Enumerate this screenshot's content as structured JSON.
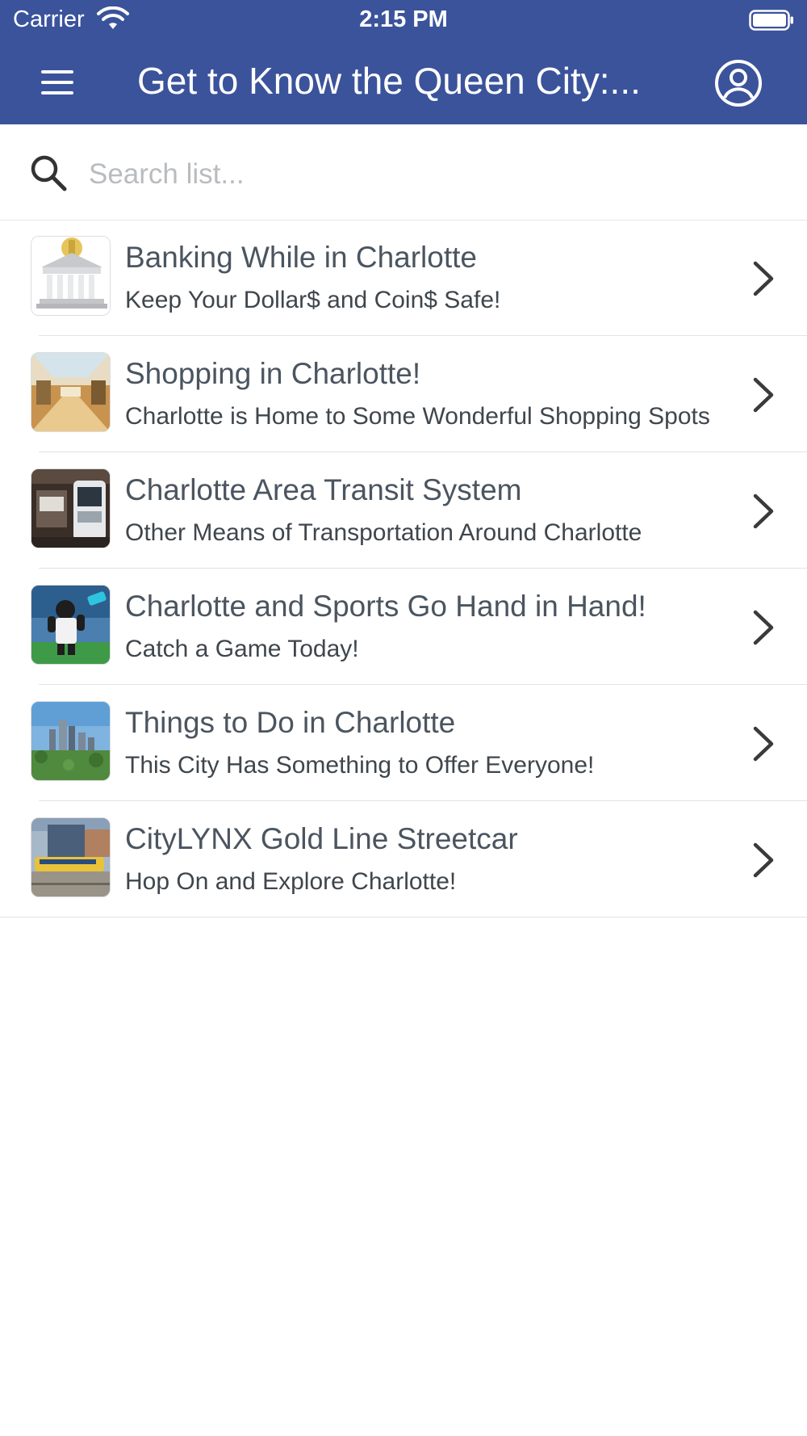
{
  "status_bar": {
    "carrier": "Carrier",
    "time": "2:15 PM",
    "wifi_icon": "wifi-icon",
    "battery_icon": "battery-icon"
  },
  "header": {
    "title": "Get to Know the Queen City:...",
    "menu_icon": "hamburger-menu-icon",
    "account_icon": "account-circle-icon",
    "background_color": "#3b539b"
  },
  "search": {
    "placeholder": "Search list...",
    "value": "",
    "icon": "search-icon"
  },
  "items": [
    {
      "title": "Banking While in Charlotte",
      "subtitle": "Keep Your Dollar$ and Coin$ Safe!",
      "thumbnail": "bank-building-image"
    },
    {
      "title": "Shopping in Charlotte!",
      "subtitle": "Charlotte is Home to Some Wonderful Shopping Spots",
      "thumbnail": "shopping-mall-image"
    },
    {
      "title": "Charlotte Area Transit System",
      "subtitle": "Other Means of Transportation Around Charlotte",
      "thumbnail": "bus-station-image"
    },
    {
      "title": "Charlotte and Sports Go Hand in Hand!",
      "subtitle": "Catch a Game Today!",
      "thumbnail": "sports-mascot-image"
    },
    {
      "title": "Things to Do in Charlotte",
      "subtitle": "This City Has Something to Offer Everyone!",
      "thumbnail": "city-skyline-image"
    },
    {
      "title": "CityLYNX Gold Line Streetcar",
      "subtitle": "Hop On and Explore Charlotte!",
      "thumbnail": "streetcar-image"
    }
  ]
}
